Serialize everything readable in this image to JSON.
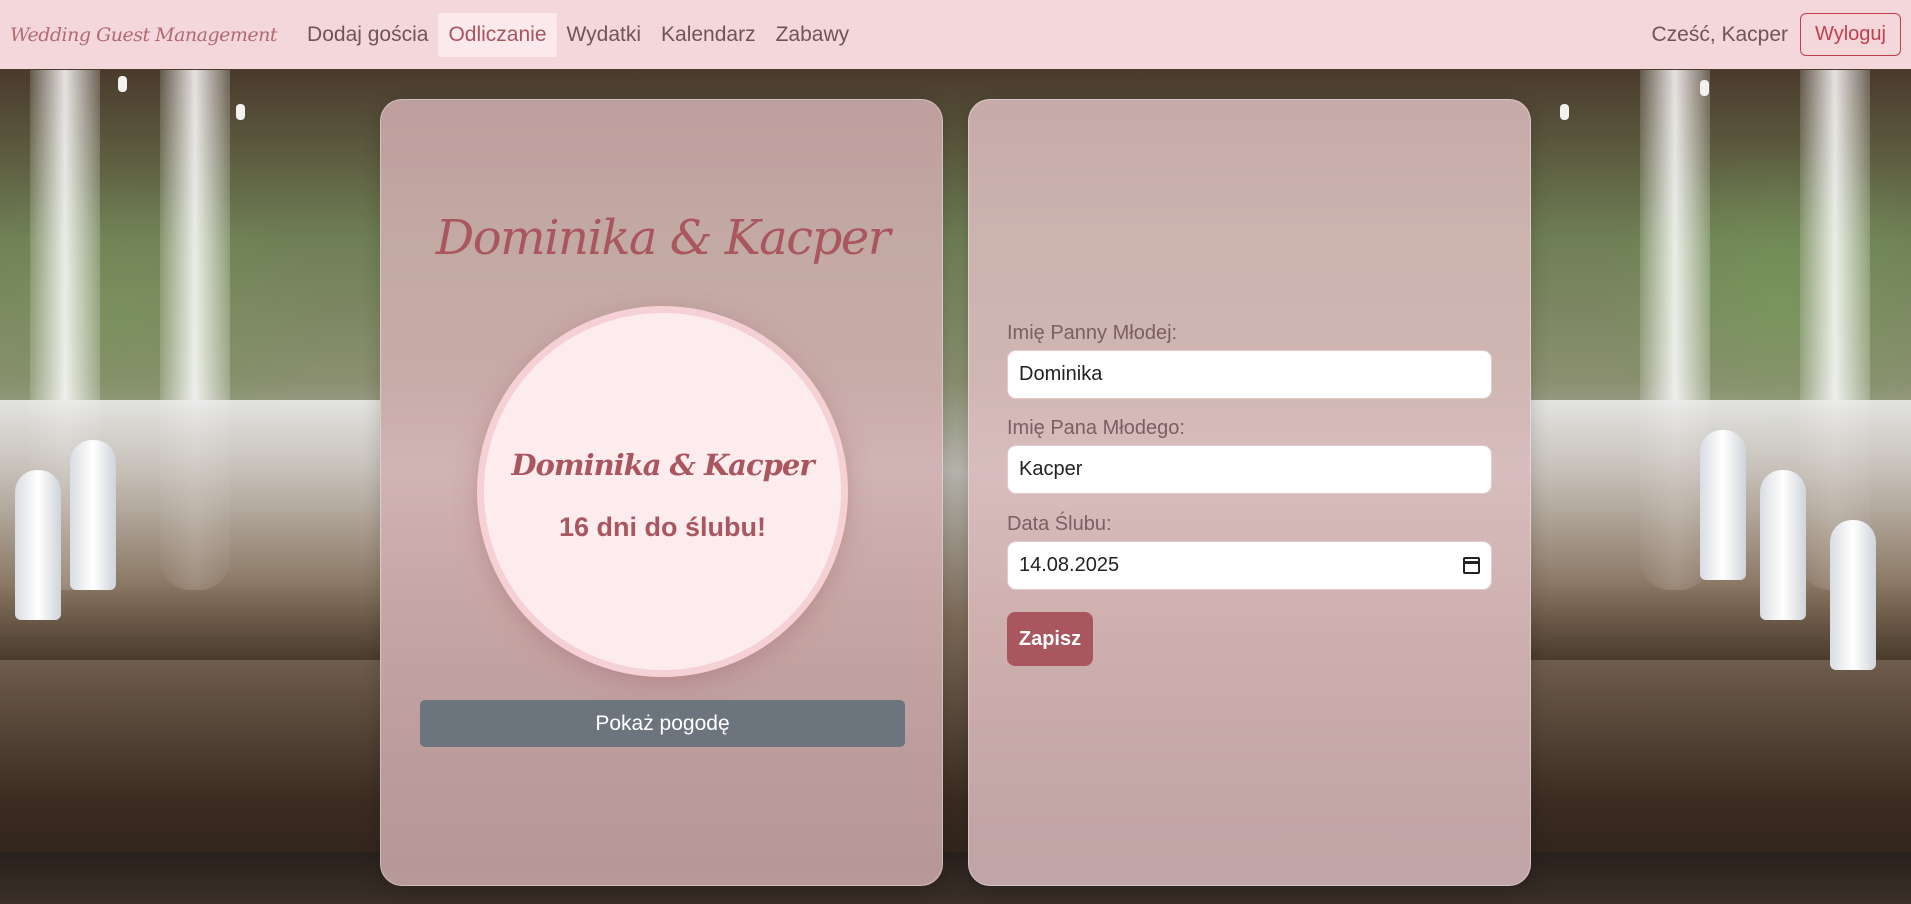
{
  "navbar": {
    "brand": "Wedding Guest Management",
    "links": [
      {
        "label": "Dodaj gościa"
      },
      {
        "label": "Odliczanie"
      },
      {
        "label": "Wydatki"
      },
      {
        "label": "Kalendarz"
      },
      {
        "label": "Zabawy"
      }
    ],
    "active_link": "Odliczanie",
    "greeting": "Cześć, Kacper",
    "logout_label": "Wyloguj"
  },
  "countdown_card": {
    "title": "Dominika & Kacper",
    "circle_names": "Dominika & Kacper",
    "countdown_text": "16 dni do ślubu!",
    "weather_button": "Pokaż pogodę"
  },
  "form": {
    "bride_label": "Imię Panny Młodej:",
    "bride_value": "Dominika",
    "groom_label": "Imię Pana Młodego:",
    "groom_value": "Kacper",
    "date_label": "Data Ślubu:",
    "date_value": "14.08.2025",
    "save_label": "Zapisz"
  },
  "colors": {
    "navbar_bg": "#f4d7da",
    "accent": "#a9565f",
    "logout": "#c0404e",
    "secondary_button": "#6c757d"
  },
  "icons": [
    "calendar-icon"
  ]
}
